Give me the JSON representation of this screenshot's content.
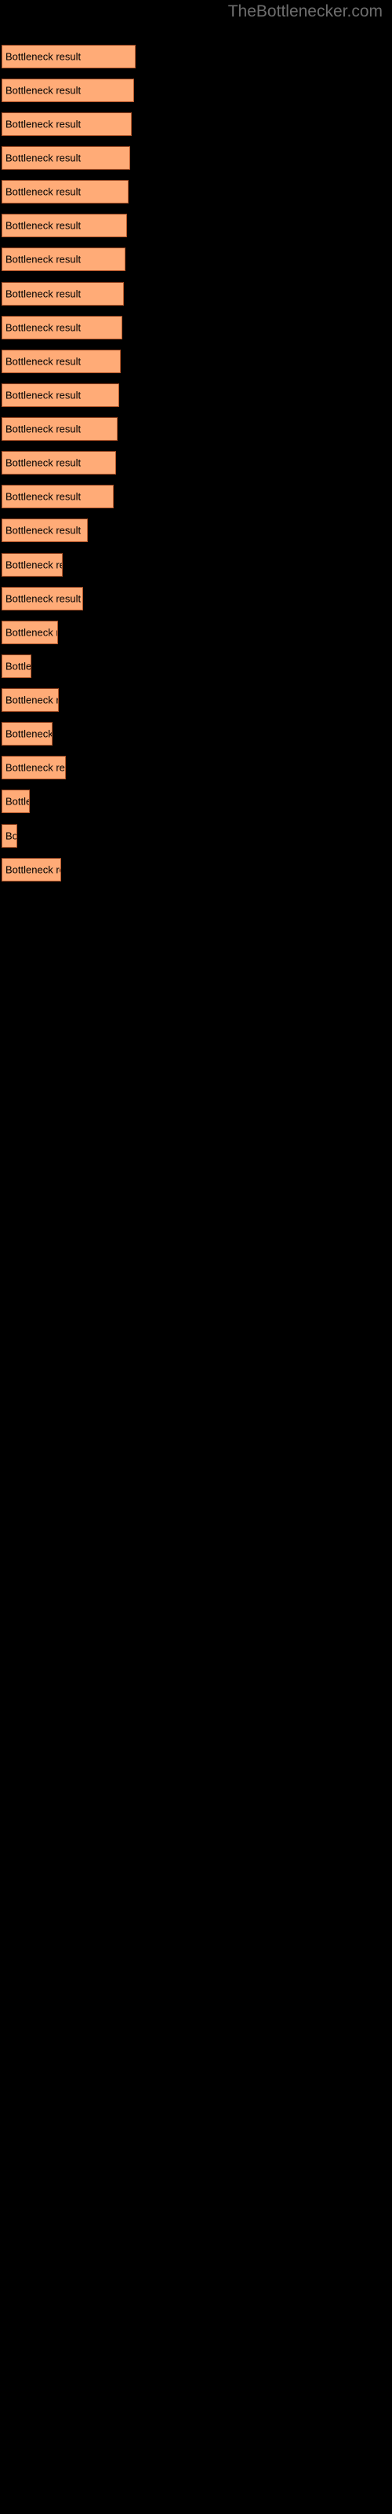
{
  "site": {
    "watermark": "TheBottlenecker.com"
  },
  "chart_data": {
    "type": "bar",
    "orientation": "horizontal",
    "title": "",
    "subtitle": "",
    "xlabel": "",
    "ylabel": "",
    "grid": false,
    "legend": "none",
    "background_color": "#000000",
    "bar_fill_color": "#ffab77",
    "bar_border_color": "#b5572a",
    "label_color": "#000000",
    "watermark_color": "#6d6d6d",
    "xlim": [
      0,
      500
    ],
    "bar_label_text": "Bottleneck result",
    "categories": [
      "Bottleneck result",
      "Bottleneck result",
      "Bottleneck result",
      "Bottleneck result",
      "Bottleneck result",
      "Bottleneck result",
      "Bottleneck result",
      "Bottleneck result",
      "Bottleneck result",
      "Bottleneck result",
      "Bottleneck result",
      "Bottleneck result",
      "Bottleneck result",
      "Bottleneck result",
      "Bottleneck result",
      "Bottleneck result",
      "Bottleneck result",
      "Bottleneck result",
      "Bottleneck result",
      "Bottleneck result",
      "Bottleneck result",
      "Bottleneck result",
      "Bottleneck result",
      "Bottleneck result",
      "Bottleneck result"
    ],
    "values": [
      171,
      169,
      166,
      164,
      162,
      160,
      158,
      156,
      154,
      152,
      150,
      148,
      146,
      143,
      110,
      78,
      104,
      72,
      38,
      73,
      65,
      82,
      36,
      20,
      76
    ],
    "bars": [
      {
        "label": "Bottleneck result",
        "width": 171,
        "top": 57
      },
      {
        "label": "Bottleneck result",
        "width": 169,
        "top": 100
      },
      {
        "label": "Bottleneck result",
        "width": 166,
        "top": 143
      },
      {
        "label": "Bottleneck result",
        "width": 164,
        "top": 186
      },
      {
        "label": "Bottleneck result",
        "width": 162,
        "top": 229
      },
      {
        "label": "Bottleneck result",
        "width": 160,
        "top": 272
      },
      {
        "label": "Bottleneck result",
        "width": 158,
        "top": 315
      },
      {
        "label": "Bottleneck result",
        "width": 156,
        "top": 359
      },
      {
        "label": "Bottleneck result",
        "width": 154,
        "top": 402
      },
      {
        "label": "Bottleneck result",
        "width": 152,
        "top": 445
      },
      {
        "label": "Bottleneck result",
        "width": 150,
        "top": 488
      },
      {
        "label": "Bottleneck result",
        "width": 148,
        "top": 531
      },
      {
        "label": "Bottleneck result",
        "width": 146,
        "top": 574
      },
      {
        "label": "Bottleneck result",
        "width": 143,
        "top": 617
      },
      {
        "label": "Bottleneck result",
        "width": 110,
        "top": 660
      },
      {
        "label": "Bottleneck result",
        "width": 78,
        "top": 704
      },
      {
        "label": "Bottleneck result",
        "width": 104,
        "top": 747
      },
      {
        "label": "Bottleneck result",
        "width": 72,
        "top": 790
      },
      {
        "label": "Bottleneck result",
        "width": 38,
        "top": 833
      },
      {
        "label": "Bottleneck result",
        "width": 73,
        "top": 876
      },
      {
        "label": "Bottleneck result",
        "width": 65,
        "top": 919
      },
      {
        "label": "Bottleneck result",
        "width": 82,
        "top": 962
      },
      {
        "label": "Bottleneck result",
        "width": 36,
        "top": 1005
      },
      {
        "label": "Bottleneck result",
        "width": 20,
        "top": 1049
      },
      {
        "label": "Bottleneck result",
        "width": 76,
        "top": 1092
      }
    ]
  }
}
